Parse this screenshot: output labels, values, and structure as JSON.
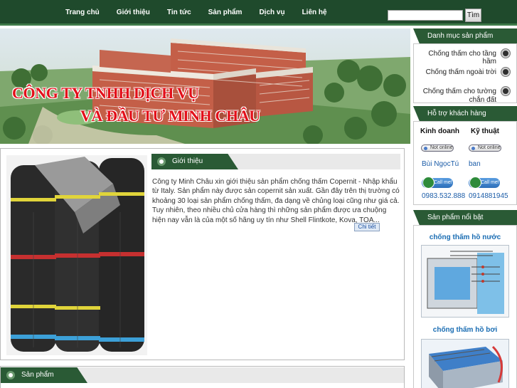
{
  "nav": {
    "items": [
      "Trang chủ",
      "Giới thiệu",
      "Tin tức",
      "Sản phẩm",
      "Dịch vụ",
      "Liên hệ"
    ]
  },
  "search": {
    "value": "",
    "button_label": "Tìm"
  },
  "banner": {
    "line1": "CÔNG TY TNHH DỊCH VỤ",
    "line2": "VÀ ĐẦU TƯ MINH CHÂU"
  },
  "intro": {
    "heading": "Giới thiệu",
    "text": "Công ty Minh Châu xin giới thiệu sản phẩm chống thấm Copernit - Nhập khẩu từ Italy. Sản phẩm này được sản copernit sản xuất. Gần đây trên thị trường có khoảng 30 loại sản phẩm chống thấm, đa dạng về chủng loại cũng như giá cả. Tuy nhiên, theo nhiều chủ cửa hàng thì những sản phẩm được ưa chuộng hiện nay vẫn là của một số hãng uy tín như Shell Flintkote, Kova, TOA...",
    "detail_label": "Chi tiết"
  },
  "products_section": {
    "heading": "Sản phẩm"
  },
  "categories": {
    "heading": "Danh mục sản phẩm",
    "items": [
      "Chống thấm cho tầng hầm",
      "Chống thấm ngoài trời",
      "Chống thấm cho tường chắn đất"
    ]
  },
  "support": {
    "heading": "Hỗ trợ khách hàng",
    "columns": [
      {
        "title": "Kinh doanh",
        "status": "Not online",
        "nick": "Bùi NgọcTú",
        "call": "Call me!",
        "phone": "0983.532.888"
      },
      {
        "title": "Kỹ thuật",
        "status": "Not online",
        "nick": "ban",
        "call": "Call me!",
        "phone": "0914881945"
      }
    ]
  },
  "featured": {
    "heading": "Sản phẩm nổi bật",
    "items": [
      {
        "title": "chống thấm hồ nước"
      },
      {
        "title": "chống thấm hồ bơi"
      }
    ]
  },
  "colors": {
    "nav_bg": "#1f4a2c",
    "header_green": "#2a5a35",
    "banner_text": "#e3101a",
    "link_blue": "#1c5da8"
  }
}
